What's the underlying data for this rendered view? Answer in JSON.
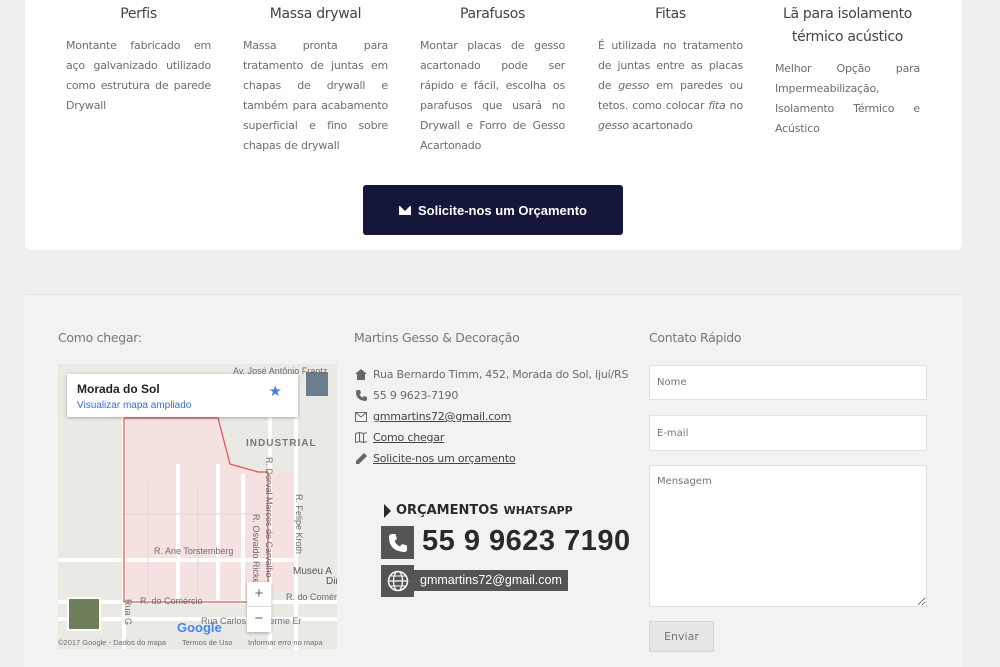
{
  "products": [
    {
      "title": "Perfis",
      "desc": "Montante fabricado em aço galvanizado utilizado como estrutura de parede Drywall"
    },
    {
      "title": "Massa drywal",
      "desc": "Massa pronta para tratamento de juntas em chapas de drywall e também para acabamento superficial e fino sobre chapas de drywall"
    },
    {
      "title": "Parafusos",
      "desc": "Montar placas de gesso acartonado pode ser rápido e fácil, escolha os parafusos que usará no Drywall e Forro de Gesso Acartonado"
    },
    {
      "title": "Fitas",
      "desc_parts": [
        "É utilizada no tratamento de juntas entre as placas de ",
        "gesso",
        " em paredes ou tetos. como colocar ",
        "fita",
        " no ",
        "gesso",
        " acartonado"
      ]
    },
    {
      "title_line1": "Lã para isolamento",
      "title_line2": "térmico acústico",
      "desc": "Melhor Opção para Impermeabilização, Isolamento Térmico e Acústico"
    }
  ],
  "cta_label": "Solicite-nos um Orçamento",
  "footer": {
    "how_to_get": "Como chegar:",
    "company_title": "Martins Gesso & Decoração",
    "contact_title": "Contato Rápido"
  },
  "map": {
    "place": "Morada do Sol",
    "link": "Visualizar mapa ampliado",
    "labels": {
      "industrial": "INDUSTRIAL",
      "ane": "R. Ane Torstemberg",
      "comercio": "R. do Comércio",
      "comercio2": "R. do Comércio",
      "museu": "Museu A",
      "museu2": "Dir",
      "carlos": "Rua Carlos Guilherme Er",
      "felipe": "R. Felipe Kroth",
      "dorval": "R. Dorval Marcos de Carvalho",
      "osvaldo": "R. Osvaldo Ricke",
      "jose": "Av. José Antônio Frantz",
      "rua": "Rua G"
    },
    "zoom_in": "+",
    "zoom_out": "−",
    "google": "Google",
    "attribution": "©2017 Google - Dados do mapa",
    "terms": "Termos de Uso",
    "report": "Informar erro no mapa"
  },
  "contacts": {
    "address": "Rua Bernardo Timm, 452, Morada do Sol, Ijuí/RS",
    "phone": "55 9 9623-7190",
    "email": "gmmartins72@gmail.com",
    "directions": "Como chegar",
    "quote": "Solicite-nos um orçamento"
  },
  "whatsapp": {
    "title": "ORÇAMENTOS",
    "title_small": "WHATSAPP",
    "number": "55 9 9623 7190",
    "email": "gmmartins72@gmail.com"
  },
  "form": {
    "name_placeholder": "Nome",
    "email_placeholder": "E-mail",
    "message_placeholder": "Mensagem",
    "send_label": "Enviar"
  },
  "colors": {
    "cta_bg": "#14173a",
    "map_route": "#d9534f",
    "link": "#3a6fce"
  }
}
